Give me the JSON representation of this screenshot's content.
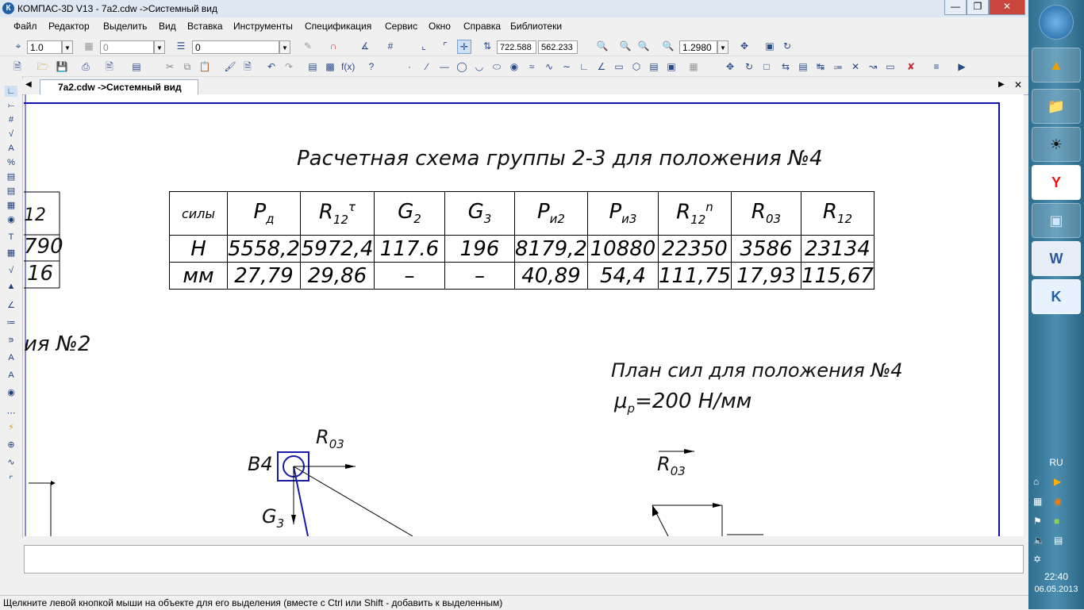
{
  "window": {
    "title": "КОМПАС-3D V13 - 7a2.cdw ->Системный вид",
    "app_icon": "К",
    "controls": [
      "minimize-icon",
      "maximize-icon",
      "close-icon"
    ]
  },
  "menu": [
    "Файл",
    "Редактор",
    "Выделить",
    "Вид",
    "Вставка",
    "Инструменты",
    "Спецификация",
    "Сервис",
    "Окно",
    "Справка",
    "Библиотеки"
  ],
  "toolbar1": {
    "step_value": "1.0",
    "layer_value": "0",
    "style_value": "0",
    "coord_x": "722.588",
    "coord_y": "562.233",
    "zoom_value": "1.2980"
  },
  "document_tab": {
    "label": "7a2.cdw ->Системный вид"
  },
  "drawing": {
    "heading": "Расчетная схема группы 2-3 для положения №4",
    "table": {
      "header_label": "силы",
      "columns": [
        {
          "base": "P",
          "sub": "д",
          "sup": ""
        },
        {
          "base": "R",
          "sub": "12",
          "sup": "τ"
        },
        {
          "base": "G",
          "sub": "2",
          "sup": ""
        },
        {
          "base": "G",
          "sub": "3",
          "sup": ""
        },
        {
          "base": "P",
          "sub": "и2",
          "sup": ""
        },
        {
          "base": "P",
          "sub": "и3",
          "sup": ""
        },
        {
          "base": "R",
          "sub": "12",
          "sup": "n"
        },
        {
          "base": "R",
          "sub": "03",
          "sup": ""
        },
        {
          "base": "R",
          "sub": "12",
          "sup": ""
        }
      ],
      "rows": [
        {
          "label": "Н",
          "values": [
            "5558,2",
            "5972,4",
            "117.6",
            "196",
            "8179,2",
            "10880",
            "22350",
            "3586",
            "23134"
          ]
        },
        {
          "label": "мм",
          "values": [
            "27,79",
            "29,86",
            "–",
            "–",
            "40,89",
            "54,4",
            "111,75",
            "17,93",
            "115,67"
          ]
        }
      ]
    },
    "left_table_fragment": [
      "12",
      "790",
      "16"
    ],
    "left_heading_fragment": "ия №2",
    "plan_title": "План сил для положения №4",
    "scale_label": "μ",
    "scale_sub": "р",
    "scale_value": "=200 Н/мм",
    "labels": {
      "b4": "B4",
      "r03_base": "R",
      "r03_sub": "03",
      "g3_base": "G",
      "g3_sub": "3"
    }
  },
  "taskbar": {
    "language": "RU",
    "time": "22:40",
    "date": "06.05.2013",
    "apps": [
      "start-orb",
      "aimp-icon",
      "explorer-icon",
      "guitar-pro-icon",
      "yandex-browser-icon",
      "image-viewer-icon",
      "word-icon",
      "kompas-icon"
    ]
  },
  "status": {
    "text": "Щелкните левой кнопкой мыши на объекте для его выделения (вместе с Ctrl или Shift - добавить к выделенным)"
  }
}
